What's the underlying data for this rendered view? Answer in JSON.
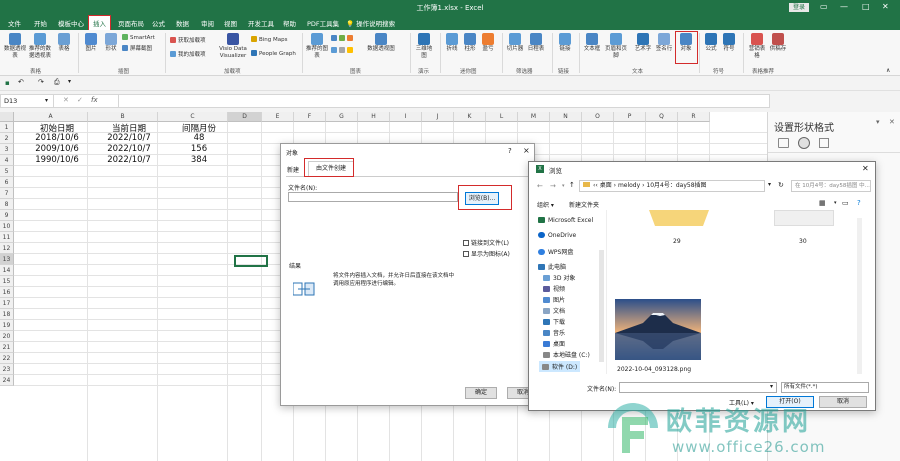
{
  "window": {
    "title": "工作簿1.xlsx  -  Excel",
    "login": "登录"
  },
  "menu": [
    "文件",
    "开始",
    "模板中心",
    "插入",
    "页面布局",
    "公式",
    "数据",
    "审阅",
    "视图",
    "开发工具",
    "帮助",
    "PDF工具集",
    "操作说明搜索"
  ],
  "ribbon": {
    "items": [
      "数据透视表",
      "推荐的数据透视表",
      "表格",
      "图片",
      "形状",
      "SmartArt",
      "屏幕截图",
      "获取加载项",
      "我的加载项",
      "Visio Data Visualizer",
      "Bing Maps",
      "People Graph",
      "推荐的图表",
      "数据透视图",
      "三维地图",
      "折线",
      "柱形",
      "盈亏",
      "切片器",
      "日程表",
      "链接",
      "文本框",
      "页眉和页脚",
      "艺术字",
      "签名行",
      "对象",
      "公式",
      "符号",
      "营销表格",
      "供稿存"
    ],
    "groups": [
      "表格",
      "插图",
      "加载项",
      "图表",
      "演示",
      "迷你图",
      "筛选器",
      "链接",
      "文本",
      "符号",
      "表格推荐"
    ]
  },
  "formula_bar": {
    "name_box": "D13",
    "fx": "fx"
  },
  "sheet": {
    "columns": [
      "A",
      "B",
      "C",
      "D",
      "E",
      "F",
      "G",
      "H",
      "I",
      "J",
      "K",
      "L",
      "M",
      "N",
      "O",
      "P",
      "Q",
      "R"
    ],
    "rows": [
      "1",
      "2",
      "3",
      "4",
      "5",
      "6",
      "7",
      "8",
      "9",
      "10",
      "11",
      "12",
      "13",
      "14",
      "15",
      "16",
      "17",
      "18",
      "19",
      "20",
      "21",
      "22",
      "23",
      "24"
    ],
    "headers": [
      "初始日期",
      "当前日期",
      "间隔月份"
    ],
    "data": [
      [
        "2018/10/6",
        "2022/10/7",
        "48"
      ],
      [
        "2009/10/6",
        "2022/10/7",
        "156"
      ],
      [
        "1990/10/6",
        "2022/10/7",
        "384"
      ]
    ]
  },
  "pane": {
    "title": "设置形状格式"
  },
  "object_dialog": {
    "title": "对象",
    "tab_new": "新建",
    "tab_file": "由文件创建",
    "file_label": "文件名(N):",
    "browse": "浏览(B)...",
    "link_label": "链接到文件(L)",
    "icon_label": "显示为图标(A)",
    "result_label": "结果",
    "result_text": "将文件内容插入文档，并允许日后直接在该文档中调用原应用程序进行编辑。",
    "ok": "确定",
    "cancel": "取消",
    "help": "?",
    "close": "×"
  },
  "browse_dialog": {
    "title": "浏览",
    "path": [
      "‹‹ 桌面",
      "melody",
      "10月4号：day58插图"
    ],
    "search_placeholder": "在 10月4号：day58插图 中...",
    "organize": "组织 ▾",
    "new_folder": "新建文件夹",
    "nav": [
      "Microsoft Excel",
      "OneDrive",
      "WPS网盘",
      "此电脑",
      "3D 对象",
      "视频",
      "图片",
      "文档",
      "下载",
      "音乐",
      "桌面",
      "本地磁盘 (C:)",
      "软件 (D:)"
    ],
    "folder_labels": [
      "29",
      "30"
    ],
    "file_name": "2022-10-04_093128.png",
    "filename_label": "文件名(N):",
    "filter": "所有文件(*.*)",
    "tools": "工具(L) ▾",
    "open": "打开(O)",
    "cancel": "取消"
  },
  "watermark": {
    "cn": "欧菲资源网",
    "url": "www.office26.com"
  },
  "colors": {
    "excel_green": "#217346",
    "highlight": "#d32b2b",
    "selected_cell": "#217346"
  }
}
